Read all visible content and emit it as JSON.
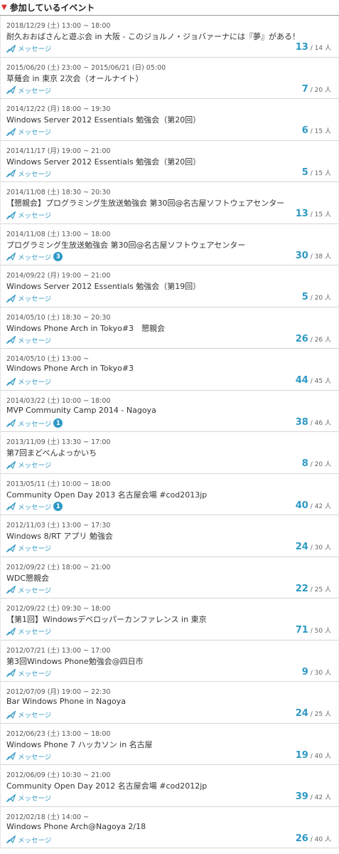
{
  "header": {
    "title": "参加しているイベント"
  },
  "message_label": "メッセージ",
  "colors": {
    "accent": "#2d99c4",
    "marker": "#e02b2b"
  },
  "events": [
    {
      "date": "2018/12/29 (土) 13:00 ~ 18:00",
      "name": "耐久おおばさんと遊ぶ会 in 大阪 - このジョルノ・ジョバァーナには『夢』がある！",
      "joined": "13",
      "capacity": "/ 14 人",
      "badge": ""
    },
    {
      "date": "2015/06/20 (土) 23:00 ~ 2015/06/21 (日) 05:00",
      "name": "草薙会 in 東京 2次会（オールナイト）",
      "joined": "7",
      "capacity": "/ 20 人",
      "badge": ""
    },
    {
      "date": "2014/12/22 (月) 18:00 ~ 19:30",
      "name": "Windows Server 2012 Essentials 勉強会（第20回）",
      "joined": "6",
      "capacity": "/ 15 人",
      "badge": ""
    },
    {
      "date": "2014/11/17 (月) 19:00 ~ 21:00",
      "name": "Windows Server 2012 Essentials 勉強会（第20回）",
      "joined": "5",
      "capacity": "/ 15 人",
      "badge": ""
    },
    {
      "date": "2014/11/08 (土) 18:30 ~ 20:30",
      "name": "【懇親会】プログラミング生放送勉強会 第30回@名古屋ソフトウェアセンター",
      "joined": "13",
      "capacity": "/ 15 人",
      "badge": ""
    },
    {
      "date": "2014/11/08 (土) 13:00 ~ 18:00",
      "name": "プログラミング生放送勉強会 第30回@名古屋ソフトウェアセンター",
      "joined": "30",
      "capacity": "/ 38 人",
      "badge": "3"
    },
    {
      "date": "2014/09/22 (月) 19:00 ~ 21:00",
      "name": "Windows Server 2012 Essentials 勉強会（第19回）",
      "joined": "5",
      "capacity": "/ 20 人",
      "badge": ""
    },
    {
      "date": "2014/05/10 (土) 18:30 ~ 20:30",
      "name": "Windows Phone Arch in Tokyo#3　懇親会",
      "joined": "26",
      "capacity": "/ 26 人",
      "badge": ""
    },
    {
      "date": "2014/05/10 (土) 13:00 ~",
      "name": "Windows Phone Arch in Tokyo#3",
      "joined": "44",
      "capacity": "/ 45 人",
      "badge": ""
    },
    {
      "date": "2014/03/22 (土) 10:00 ~ 18:00",
      "name": "MVP Community Camp 2014 - Nagoya",
      "joined": "38",
      "capacity": "/ 46 人",
      "badge": "1"
    },
    {
      "date": "2013/11/09 (土) 13:30 ~ 17:00",
      "name": "第7回まどべんよっかいち",
      "joined": "8",
      "capacity": "/ 20 人",
      "badge": ""
    },
    {
      "date": "2013/05/11 (土) 10:00 ~ 18:00",
      "name": "Community Open Day 2013 名古屋会場 #cod2013jp",
      "joined": "40",
      "capacity": "/ 42 人",
      "badge": "1"
    },
    {
      "date": "2012/11/03 (土) 13:00 ~ 17:30",
      "name": "Windows 8/RT アプリ 勉強会",
      "joined": "24",
      "capacity": "/ 30 人",
      "badge": ""
    },
    {
      "date": "2012/09/22 (土) 18:00 ~ 21:00",
      "name": "WDC懇親会",
      "joined": "22",
      "capacity": "/ 25 人",
      "badge": ""
    },
    {
      "date": "2012/09/22 (土) 09:30 ~ 18:00",
      "name": "【第1回】Windowsデベロッパーカンファレンス in 東京",
      "joined": "71",
      "capacity": "/ 50 人",
      "badge": ""
    },
    {
      "date": "2012/07/21 (土) 13:00 ~ 17:00",
      "name": "第3回Windows Phone勉強会@四日市",
      "joined": "9",
      "capacity": "/ 30 人",
      "badge": ""
    },
    {
      "date": "2012/07/09 (月) 19:00 ~ 22:30",
      "name": "Bar Windows Phone in Nagoya",
      "joined": "24",
      "capacity": "/ 25 人",
      "badge": ""
    },
    {
      "date": "2012/06/23 (土) 13:00 ~ 18:00",
      "name": "Windows Phone 7 ハッカソン in 名古屋",
      "joined": "19",
      "capacity": "/ 40 人",
      "badge": ""
    },
    {
      "date": "2012/06/09 (土) 10:30 ~ 21:00",
      "name": "Community Open Day 2012 名古屋会場 #cod2012jp",
      "joined": "39",
      "capacity": "/ 42 人",
      "badge": ""
    },
    {
      "date": "2012/02/18 (土) 14:00 ~",
      "name": "Windows Phone Arch@Nagoya 2/18",
      "joined": "26",
      "capacity": "/ 40 人",
      "badge": ""
    }
  ]
}
